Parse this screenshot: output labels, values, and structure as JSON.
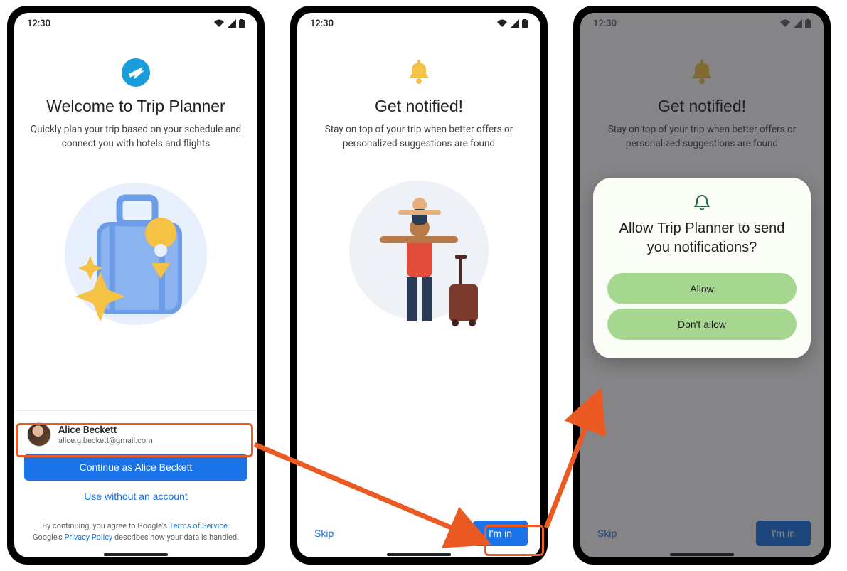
{
  "statusbar": {
    "time": "12:30"
  },
  "screen1": {
    "title": "Welcome to Trip Planner",
    "subtitle": "Quickly plan your trip based on your schedule and connect you with hotels and flights",
    "account": {
      "name": "Alice Beckett",
      "email": "alice.g.beckett@gmail.com"
    },
    "continue_btn": "Continue as Alice Beckett",
    "no_account_btn": "Use without an account",
    "legal_pre": "By continuing, you agree to Google's ",
    "tos": "Terms of Service",
    "legal_mid": ". Google's ",
    "privacy": "Privacy Policy",
    "legal_post": " describes how your data is handled."
  },
  "screen2": {
    "title": "Get notified!",
    "subtitle": "Stay on top of your trip when better offers or personalized suggestions are found",
    "skip": "Skip",
    "im_in": "I'm in"
  },
  "screen3": {
    "title": "Get notified!",
    "subtitle": "Stay on top of your trip when better offers or personalized suggestions are found",
    "skip": "Skip",
    "im_in": "I'm in",
    "dialog_prefix": "Allow ",
    "dialog_app": "Trip Planner",
    "dialog_suffix": " to send you notifications?",
    "allow": "Allow",
    "deny": "Don't allow"
  },
  "colors": {
    "primary": "#1a73e8",
    "highlight": "#eb5a23",
    "dialog_btn": "#a6d790"
  }
}
